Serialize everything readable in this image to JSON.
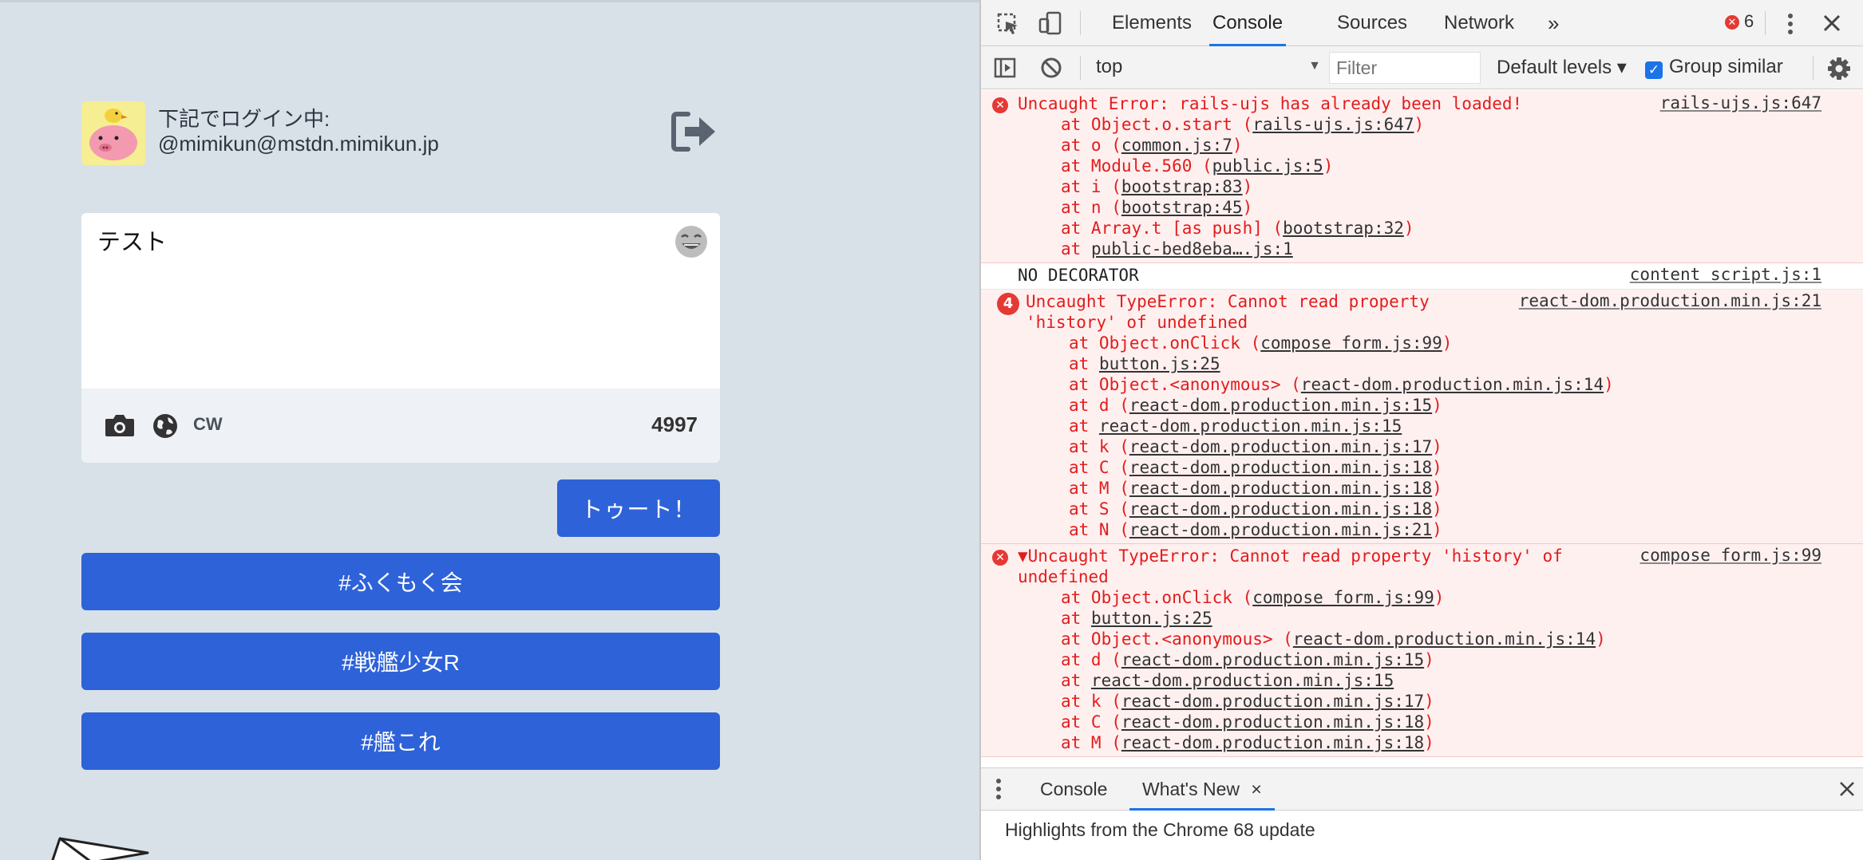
{
  "app": {
    "account": {
      "label": "下記でログイン中:",
      "handle": "@mimikun@mstdn.mimikun.jp"
    },
    "compose": {
      "text": "テスト",
      "cw_label": "CW",
      "char_count": "4997"
    },
    "toot_label": "トゥート！",
    "hashtag_buttons": [
      "#ふくもく会",
      "#戦艦少女R",
      "#艦これ"
    ]
  },
  "devtools": {
    "tabs": [
      "Elements",
      "Console",
      "Sources",
      "Network"
    ],
    "more_tabs": "»",
    "error_count": "6",
    "context": "top",
    "filter_placeholder": "Filter",
    "levels_label": "Default levels ▾",
    "group_similar_label": "Group similar",
    "messages": [
      {
        "type": "error",
        "lines": [
          "Uncaught Error: rails-ujs has already been loaded!"
        ],
        "source": "rails-ujs.js:647",
        "stack": [
          {
            "pre": "at Object.o.start (",
            "link": "rails-ujs.js:647",
            "post": ")"
          },
          {
            "pre": "at o (",
            "link": "common.js:7",
            "post": ")"
          },
          {
            "pre": "at Module.560 (",
            "link": "public.js:5",
            "post": ")"
          },
          {
            "pre": "at i (",
            "link": "bootstrap:83",
            "post": ")"
          },
          {
            "pre": "at n (",
            "link": "bootstrap:45",
            "post": ")"
          },
          {
            "pre": "at Array.t [as push] (",
            "link": "bootstrap:32",
            "post": ")"
          },
          {
            "pre": "at ",
            "link": "public-bed8eba….js:1",
            "post": ""
          }
        ]
      },
      {
        "type": "info",
        "lines": [
          "NO DECORATOR"
        ],
        "source": "content script.js:1",
        "stack": []
      },
      {
        "type": "error",
        "count": "4",
        "lines": [
          "Uncaught TypeError: Cannot read property",
          "'history' of undefined"
        ],
        "source": "react-dom.production.min.js:21",
        "stack": [
          {
            "pre": "at Object.onClick (",
            "link": "compose form.js:99",
            "post": ")"
          },
          {
            "pre": "at ",
            "link": "button.js:25",
            "post": ""
          },
          {
            "pre": "at Object.<anonymous> (",
            "link": "react-dom.production.min.js:14",
            "post": ")"
          },
          {
            "pre": "at d (",
            "link": "react-dom.production.min.js:15",
            "post": ")"
          },
          {
            "pre": "at ",
            "link": "react-dom.production.min.js:15",
            "post": ""
          },
          {
            "pre": "at k (",
            "link": "react-dom.production.min.js:17",
            "post": ")"
          },
          {
            "pre": "at C (",
            "link": "react-dom.production.min.js:18",
            "post": ")"
          },
          {
            "pre": "at M (",
            "link": "react-dom.production.min.js:18",
            "post": ")"
          },
          {
            "pre": "at S (",
            "link": "react-dom.production.min.js:18",
            "post": ")"
          },
          {
            "pre": "at N (",
            "link": "react-dom.production.min.js:21",
            "post": ")"
          }
        ]
      },
      {
        "type": "error",
        "expanded": true,
        "lines": [
          "▼Uncaught TypeError: Cannot read property 'history' of",
          "undefined"
        ],
        "source": "compose form.js:99",
        "stack": [
          {
            "pre": "at Object.onClick (",
            "link": "compose form.js:99",
            "post": ")"
          },
          {
            "pre": "at ",
            "link": "button.js:25",
            "post": ""
          },
          {
            "pre": "at Object.<anonymous> (",
            "link": "react-dom.production.min.js:14",
            "post": ")"
          },
          {
            "pre": "at d (",
            "link": "react-dom.production.min.js:15",
            "post": ")"
          },
          {
            "pre": "at ",
            "link": "react-dom.production.min.js:15",
            "post": ""
          },
          {
            "pre": "at k (",
            "link": "react-dom.production.min.js:17",
            "post": ")"
          },
          {
            "pre": "at C (",
            "link": "react-dom.production.min.js:18",
            "post": ")"
          },
          {
            "pre": "at M (",
            "link": "react-dom.production.min.js:18",
            "post": ")"
          }
        ]
      }
    ],
    "drawer": {
      "tabs": [
        "Console",
        "What's New"
      ],
      "close_symbol": "×",
      "content": "Highlights from the Chrome 68 update"
    }
  },
  "colors": {
    "app_bg": "#d9e1e8",
    "button_blue": "#2e62d8",
    "error_red": "#e31c1c",
    "error_bg": "#fff0f0",
    "devtools_accent": "#1a73e8"
  }
}
